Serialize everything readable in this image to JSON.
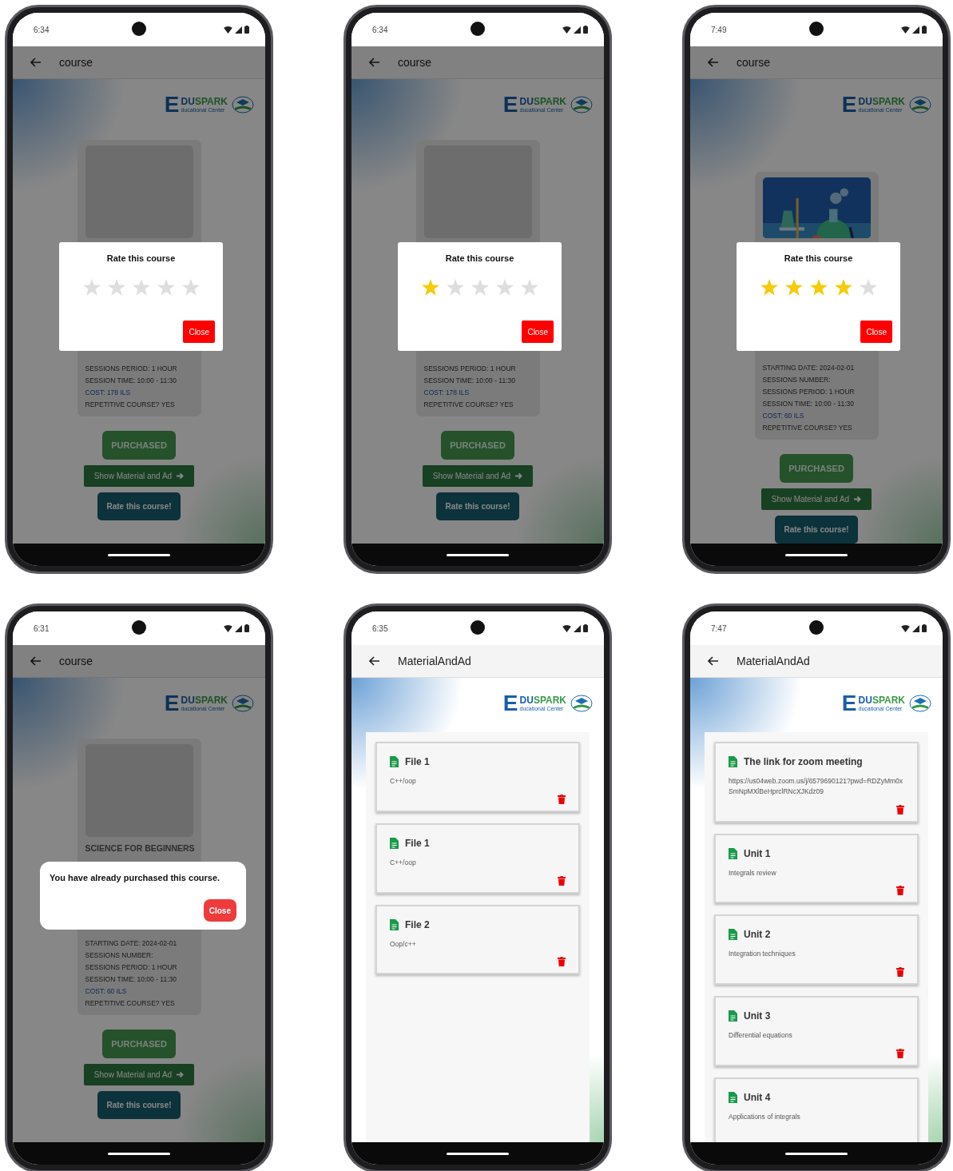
{
  "screens": [
    {
      "kind": "course",
      "time": "6:34",
      "title": "course",
      "logo": {
        "letter": "E",
        "name_first": "DU",
        "name_rest": "SPARK",
        "tagline": "ducational Center"
      },
      "card": {
        "image": {
          "kind": "blank"
        },
        "lines": [
          {
            "kind": "info",
            "text": "SESSIONS PERIOD: 1 HOUR"
          },
          {
            "kind": "info",
            "text": "SESSION TIME: 10:00 - 11:30"
          },
          {
            "kind": "cost",
            "text": "COST: 178 ILS"
          },
          {
            "kind": "info",
            "text": "REPETITIVE COURSE? YES"
          }
        ]
      },
      "buttons": [
        {
          "kind": "purchased",
          "label": "PURCHASED"
        },
        {
          "kind": "material",
          "label": "Show Material and Ad"
        },
        {
          "kind": "rate",
          "label": "Rate this course!"
        }
      ],
      "dialog": {
        "kind": "rating",
        "title": "Rate this course",
        "stars": 0,
        "close": "Close"
      }
    },
    {
      "kind": "course",
      "time": "6:34",
      "title": "course",
      "logo": {
        "letter": "E",
        "name_first": "DU",
        "name_rest": "SPARK",
        "tagline": "ducational Center"
      },
      "card": {
        "image": {
          "kind": "blank"
        },
        "lines": [
          {
            "kind": "info",
            "text": "SESSIONS PERIOD: 1 HOUR"
          },
          {
            "kind": "info",
            "text": "SESSION TIME: 10:00 - 11:30"
          },
          {
            "kind": "cost",
            "text": "COST: 178 ILS"
          },
          {
            "kind": "info",
            "text": "REPETITIVE COURSE? YES"
          }
        ]
      },
      "buttons": [
        {
          "kind": "purchased",
          "label": "PURCHASED"
        },
        {
          "kind": "material",
          "label": "Show Material and Ad"
        },
        {
          "kind": "rate",
          "label": "Rate this course!"
        }
      ],
      "dialog": {
        "kind": "rating",
        "title": "Rate this course",
        "stars": 1,
        "close": "Close"
      }
    },
    {
      "kind": "course",
      "time": "7:49",
      "title": "course",
      "logo": {
        "letter": "E",
        "name_first": "DU",
        "name_rest": "SPARK",
        "tagline": "ducational Center"
      },
      "card": {
        "lines": [
          {
            "kind": "info",
            "text": "STARTING DATE: 2024-02-01"
          },
          {
            "kind": "info",
            "text": "SESSIONS NUMBER:"
          },
          {
            "kind": "info",
            "text": "SESSIONS PERIOD: 1 HOUR"
          },
          {
            "kind": "info",
            "text": "SESSION TIME: 10:00 - 11:30"
          },
          {
            "kind": "cost",
            "text": "COST: 60 ILS"
          },
          {
            "kind": "info",
            "text": "REPETITIVE COURSE? YES"
          }
        ]
      },
      "buttons": [
        {
          "kind": "purchased",
          "label": "PURCHASED"
        },
        {
          "kind": "material",
          "label": "Show Material and Ad"
        },
        {
          "kind": "rate",
          "label": "Rate this course!"
        }
      ],
      "dialog": {
        "kind": "rating",
        "title": "Rate this course",
        "stars": 4,
        "close": "Close"
      }
    },
    {
      "kind": "course",
      "time": "6:31",
      "title": "course",
      "logo": {
        "letter": "E",
        "name_first": "DU",
        "name_rest": "SPARK",
        "tagline": "ducational Center"
      },
      "card": {
        "image": {
          "kind": "blank"
        },
        "heading": "SCIENCE FOR BEGINNERS",
        "lines": [
          {
            "kind": "info",
            "text": "STARTING DATE: 2024-02-01"
          },
          {
            "kind": "info",
            "text": "SESSIONS NUMBER:"
          },
          {
            "kind": "info",
            "text": "SESSIONS PERIOD: 1 HOUR"
          },
          {
            "kind": "info",
            "text": "SESSION TIME: 10:00 - 11:30"
          },
          {
            "kind": "cost",
            "text": "COST: 60 ILS"
          },
          {
            "kind": "info",
            "text": "REPETITIVE COURSE? YES"
          }
        ]
      },
      "buttons": [
        {
          "kind": "purchased",
          "label": "PURCHASED"
        },
        {
          "kind": "material",
          "label": "Show Material and Ad"
        },
        {
          "kind": "rate",
          "label": "Rate this course!"
        }
      ],
      "dialog": {
        "kind": "message",
        "text": "You have already purchased this course.",
        "close": "Close"
      }
    },
    {
      "kind": "material",
      "time": "6:35",
      "title": "MaterialAndAd",
      "logo": {
        "letter": "E",
        "name_first": "DU",
        "name_rest": "SPARK",
        "tagline": "ducational Center"
      },
      "items": [
        {
          "title": "File 1",
          "subtitle": "C++/oop",
          "trash_icon": true
        },
        {
          "title": "File 1",
          "subtitle": "C++/oop",
          "trash_icon": true
        },
        {
          "title": "File 2",
          "subtitle": "Oop/c++",
          "trash_icon": true
        }
      ]
    },
    {
      "kind": "material",
      "time": "7:47",
      "title": "MaterialAndAd",
      "logo": {
        "letter": "E",
        "name_first": "DU",
        "name_rest": "SPARK",
        "tagline": "ducational Center"
      },
      "items": [
        {
          "title": "The link for zoom meeting",
          "subtitle": "https://us04web.zoom.us/j/6579690121?pwd=RDZyMm0xSmNpMXlBeHprclRNcXJKdz09",
          "trash_icon": true
        },
        {
          "title": "Unit 1",
          "subtitle": "Integrals review",
          "trash_icon": true
        },
        {
          "title": "Unit 2",
          "subtitle": "Integration techniques",
          "trash_icon": true
        },
        {
          "title": "Unit 3",
          "subtitle": "Differential equations",
          "trash_icon": true
        },
        {
          "title": "Unit 4",
          "subtitle": "Applications of integrals",
          "trash_icon": false
        }
      ]
    }
  ]
}
